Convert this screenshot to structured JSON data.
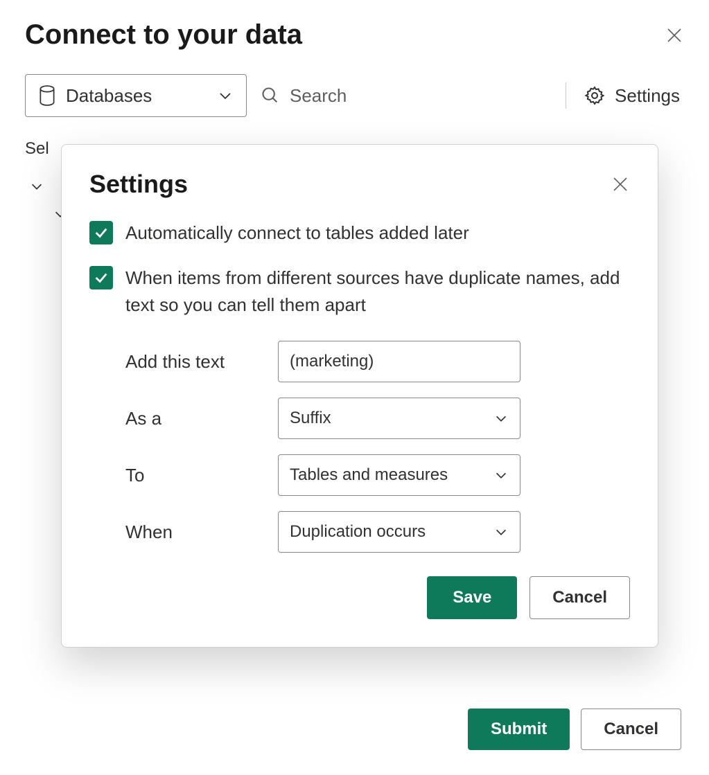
{
  "colors": {
    "accent": "#0f7a5a",
    "checkbox": "#0f7a5a"
  },
  "page": {
    "title": "Connect to your data",
    "select_label": "Sel"
  },
  "toolbar": {
    "source_selected": "Databases",
    "search_placeholder": "Search",
    "settings_label": "Settings"
  },
  "footer": {
    "submit_label": "Submit",
    "cancel_label": "Cancel"
  },
  "modal": {
    "title": "Settings",
    "auto_connect_label": "Automatically connect to tables added later",
    "duplicate_names_label": "When items from different sources have duplicate names, add text so you can tell them apart",
    "fields": {
      "add_text_label": "Add this text",
      "add_text_value": "(marketing)",
      "as_label": "As a",
      "as_value": "Suffix",
      "to_label": "To",
      "to_value": "Tables and measures",
      "when_label": "When",
      "when_value": "Duplication occurs"
    },
    "save_label": "Save",
    "cancel_label": "Cancel"
  }
}
